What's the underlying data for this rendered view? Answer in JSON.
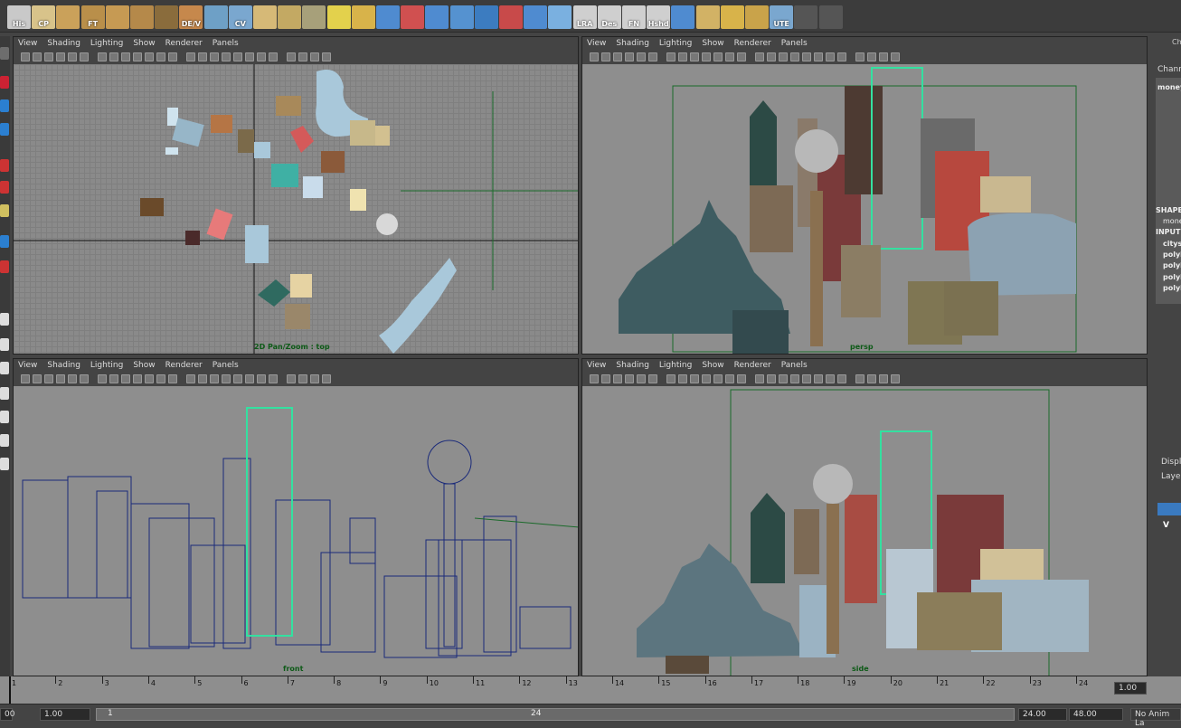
{
  "shelf": {
    "buttons": [
      {
        "name": "history-icon",
        "label": "His",
        "color": "#c9c9c9"
      },
      {
        "name": "center-pivot-icon",
        "label": "CP",
        "color": "#d8c38a"
      },
      {
        "name": "cube-cluster-icon",
        "label": "",
        "color": "#caa15a"
      },
      {
        "name": "freeze-transform-icon",
        "label": "FT",
        "color": "#b98f4a"
      },
      {
        "name": "box-icon",
        "label": "",
        "color": "#c69a53"
      },
      {
        "name": "cylinder-icon",
        "label": "",
        "color": "#b5894a"
      },
      {
        "name": "sphere-icon",
        "label": "",
        "color": "#8a6c3c"
      },
      {
        "name": "delete-vertex-icon",
        "label": "DE/V",
        "color": "#c6884c"
      },
      {
        "name": "grid-cube-icon",
        "label": "",
        "color": "#6ea0c6"
      },
      {
        "name": "curve-icon",
        "label": "CV",
        "color": "#7aa7cf"
      },
      {
        "name": "paint-icon",
        "label": "",
        "color": "#d6b977"
      },
      {
        "name": "plane-icon",
        "label": "",
        "color": "#c3a963"
      },
      {
        "name": "extrude-icon",
        "label": "",
        "color": "#a7a07a"
      },
      {
        "name": "wand-icon",
        "label": "",
        "color": "#e3d14c"
      },
      {
        "name": "checker-icon",
        "label": "",
        "color": "#d8b34a"
      },
      {
        "name": "vertex-icon",
        "label": "",
        "color": "#4f8bd0"
      },
      {
        "name": "edge-red-icon",
        "label": "",
        "color": "#d05050"
      },
      {
        "name": "edge-blue-icon",
        "label": "",
        "color": "#4f8bd0"
      },
      {
        "name": "curve-points-icon",
        "label": "",
        "color": "#5592d0"
      },
      {
        "name": "bend-icon",
        "label": "",
        "color": "#3c7cc0"
      },
      {
        "name": "spiral-red-icon",
        "label": "",
        "color": "#c84a4a"
      },
      {
        "name": "spiral-blue-icon",
        "label": "",
        "color": "#4f8bd0"
      },
      {
        "name": "wave-icon",
        "label": "",
        "color": "#7ab0e0"
      },
      {
        "name": "lra-icon",
        "label": "LRA",
        "color": "#cfcfcf"
      },
      {
        "name": "deselect-icon",
        "label": "Des",
        "color": "#cfcfcf"
      },
      {
        "name": "normals-icon",
        "label": "FN",
        "color": "#cfcfcf"
      },
      {
        "name": "hardness-icon",
        "label": "Hshd",
        "color": "#cfcfcf"
      },
      {
        "name": "circle-icon",
        "label": "",
        "color": "#4f8bd0"
      },
      {
        "name": "mesh-a-icon",
        "label": "",
        "color": "#d2b265"
      },
      {
        "name": "mesh-b-icon",
        "label": "",
        "color": "#d8b34a"
      },
      {
        "name": "mesh-c-icon",
        "label": "",
        "color": "#c9a34a"
      },
      {
        "name": "ute-icon",
        "label": "UTE",
        "color": "#7aa7cf"
      },
      {
        "name": "wifi-a-icon",
        "label": "",
        "color": "#555"
      },
      {
        "name": "wifi-b-icon",
        "label": "",
        "color": "#555"
      }
    ]
  },
  "panes": [
    {
      "id": "top",
      "menus": [
        "View",
        "Shading",
        "Lighting",
        "Show",
        "Renderer",
        "Panels"
      ],
      "label": "2D Pan/Zoom : top"
    },
    {
      "id": "persp",
      "menus": [
        "View",
        "Shading",
        "Lighting",
        "Show",
        "Renderer",
        "Panels"
      ],
      "label": "persp"
    },
    {
      "id": "front",
      "menus": [
        "View",
        "Shading",
        "Lighting",
        "Show",
        "Renderer",
        "Panels"
      ],
      "label": "front"
    },
    {
      "id": "side",
      "menus": [
        "View",
        "Shading",
        "Lighting",
        "Show",
        "Renderer",
        "Panels"
      ],
      "label": "side"
    }
  ],
  "channel_box": {
    "header": "Ch",
    "title": "Chann",
    "object": "money",
    "shapes_label": "SHAPE",
    "shape_item": "mone",
    "inputs_label": "INPUTS",
    "inputs": [
      "citys",
      "polyl",
      "polyl",
      "polyl",
      "polyl"
    ],
    "tab_display": "Displ",
    "tab_layer": "Layer",
    "visibility": "V"
  },
  "timeline": {
    "ticks": [
      "1",
      "2",
      "3",
      "4",
      "5",
      "6",
      "7",
      "8",
      "9",
      "10",
      "11",
      "12",
      "13",
      "14",
      "15",
      "16",
      "17",
      "18",
      "19",
      "20",
      "21",
      "22",
      "23",
      "24"
    ],
    "current": "1.00"
  },
  "range": {
    "start": "1.00",
    "playback_start": "1.00",
    "range_start": "1",
    "range_end": "24",
    "playback_end": "24.00",
    "end": "48.00",
    "anim_layer": "No Anim La",
    "left_partial": "00"
  }
}
